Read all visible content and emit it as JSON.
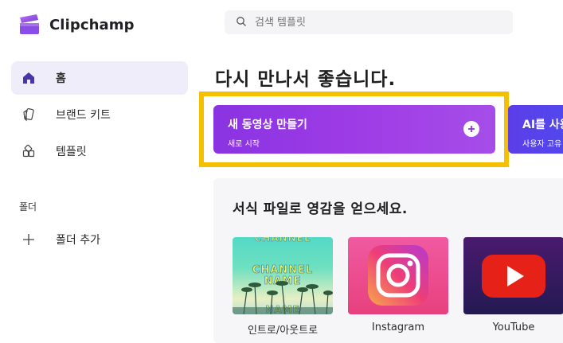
{
  "app": {
    "name": "Clipchamp"
  },
  "sidebar": {
    "items": [
      {
        "label": "홈",
        "icon": "home-icon",
        "active": true
      },
      {
        "label": "브랜드 키트",
        "icon": "brand-kit-icon",
        "active": false
      },
      {
        "label": "템플릿",
        "icon": "templates-icon",
        "active": false
      }
    ],
    "folder_section_label": "폴더",
    "add_folder_label": "폴더 추가"
  },
  "search": {
    "placeholder": "검색 템플릿",
    "icon": "search-icon"
  },
  "greeting": "다시 만나서 좋습니다.",
  "cards": {
    "new_video": {
      "title": "새 동영상 만들기",
      "subtitle": "새로 시작"
    },
    "ai": {
      "title": "AI를 사용",
      "subtitle": "사용자 고유"
    }
  },
  "templates": {
    "heading": "서식 파일로 영감을 얻으세요.",
    "items": [
      {
        "label": "인트로/아웃트로",
        "overlay": [
          "CHANNEL",
          "CHANNEL",
          "NAME",
          "NAME"
        ]
      },
      {
        "label": "Instagram"
      },
      {
        "label": "YouTube"
      }
    ]
  },
  "colors": {
    "accent": "#8a33e2",
    "highlight": "#f5c000",
    "active_nav_bg": "#efedfa",
    "ai_card": "#5c3ee8"
  }
}
